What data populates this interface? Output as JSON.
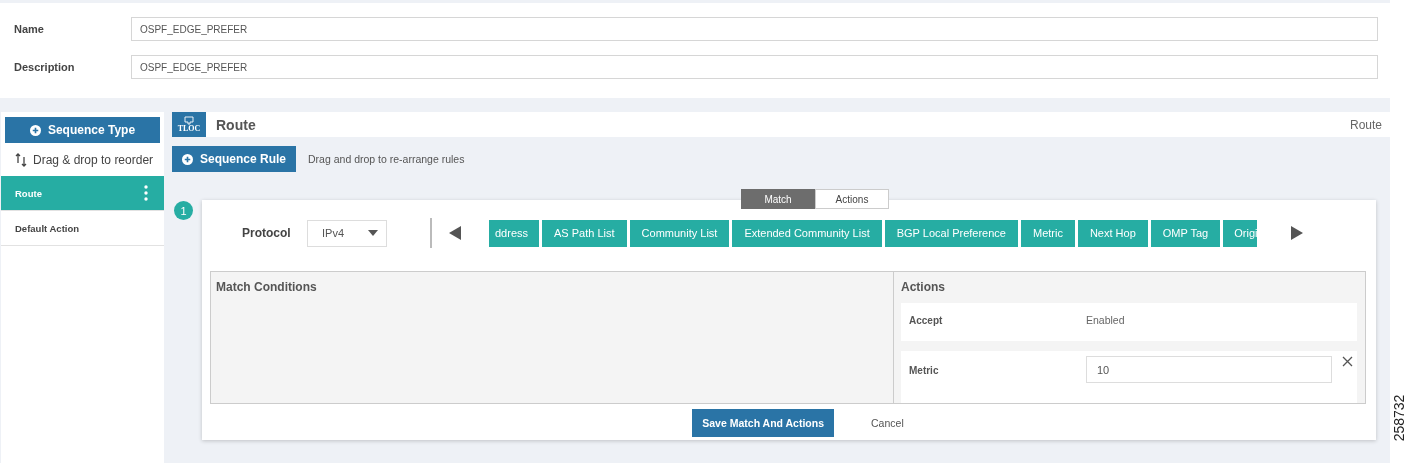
{
  "form": {
    "fields": [
      {
        "label": "Name",
        "value": "OSPF_EDGE_PREFER"
      },
      {
        "label": "Description",
        "value": "OSPF_EDGE_PREFER"
      }
    ]
  },
  "sidebar": {
    "add_button": "Sequence Type",
    "reorder_hint": "Drag & drop to reorder",
    "items": [
      {
        "label": "Route",
        "selected": true
      },
      {
        "label": "Default Action",
        "selected": false
      }
    ]
  },
  "header": {
    "icon_text": "TLOC",
    "title": "Route",
    "type_label": "Route"
  },
  "toolbar": {
    "add_button": "Sequence Rule",
    "hint": "Drag and drop to re-arrange rules"
  },
  "rule": {
    "number": "1",
    "tabs": [
      {
        "label": "Match",
        "selected": true
      },
      {
        "label": "Actions",
        "selected": false
      }
    ],
    "protocol": {
      "label": "Protocol",
      "value": "IPv4"
    },
    "match_chips": [
      "ddress",
      "AS Path List",
      "Community List",
      "Extended Community List",
      "BGP Local Preference",
      "Metric",
      "Next Hop",
      "OMP Tag",
      "Origi"
    ],
    "match_conditions": {
      "title": "Match Conditions"
    },
    "actions": {
      "title": "Actions",
      "rows": [
        {
          "kind": "text",
          "label": "Accept",
          "value": "Enabled"
        },
        {
          "kind": "input",
          "label": "Metric",
          "value": "10"
        }
      ]
    },
    "buttons": {
      "save": "Save Match And Actions",
      "cancel": "Cancel"
    }
  },
  "figure_number": "258732"
}
